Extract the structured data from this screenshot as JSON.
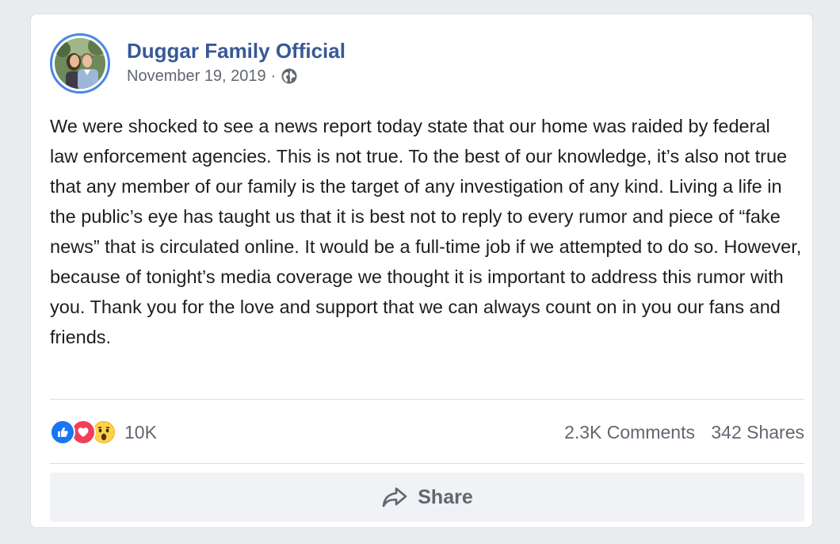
{
  "post": {
    "page_name": "Duggar Family Official",
    "date": "November 19, 2019",
    "separator": "·",
    "privacy_icon": "globe-icon",
    "text": "We were shocked to see a news report today state that our home was raided by federal law enforcement agencies. This is not true. To the best of our knowledge, it’s also not true that any member of our family is the target of any investigation of any kind. Living a life in the public’s eye has taught us that it is best not to reply to every rumor and piece of “fake news” that is circulated online. It would be a full-time job if we attempted to do so. However, because of tonight’s media coverage we thought it is important to address this rumor with you. Thank you for the love and support that we can always count on in you our fans and friends."
  },
  "reactions": {
    "icons": [
      "like-icon",
      "love-icon",
      "wow-icon"
    ],
    "count": "10K",
    "comments": "2.3K Comments",
    "shares": "342 Shares"
  },
  "actions": {
    "share_label": "Share",
    "share_icon": "share-arrow-icon"
  },
  "colors": {
    "page_name": "#385898",
    "avatar_ring": "#4a86e8",
    "like": "#1877f2",
    "love": "#f33e58",
    "wow": "#f7b125"
  }
}
